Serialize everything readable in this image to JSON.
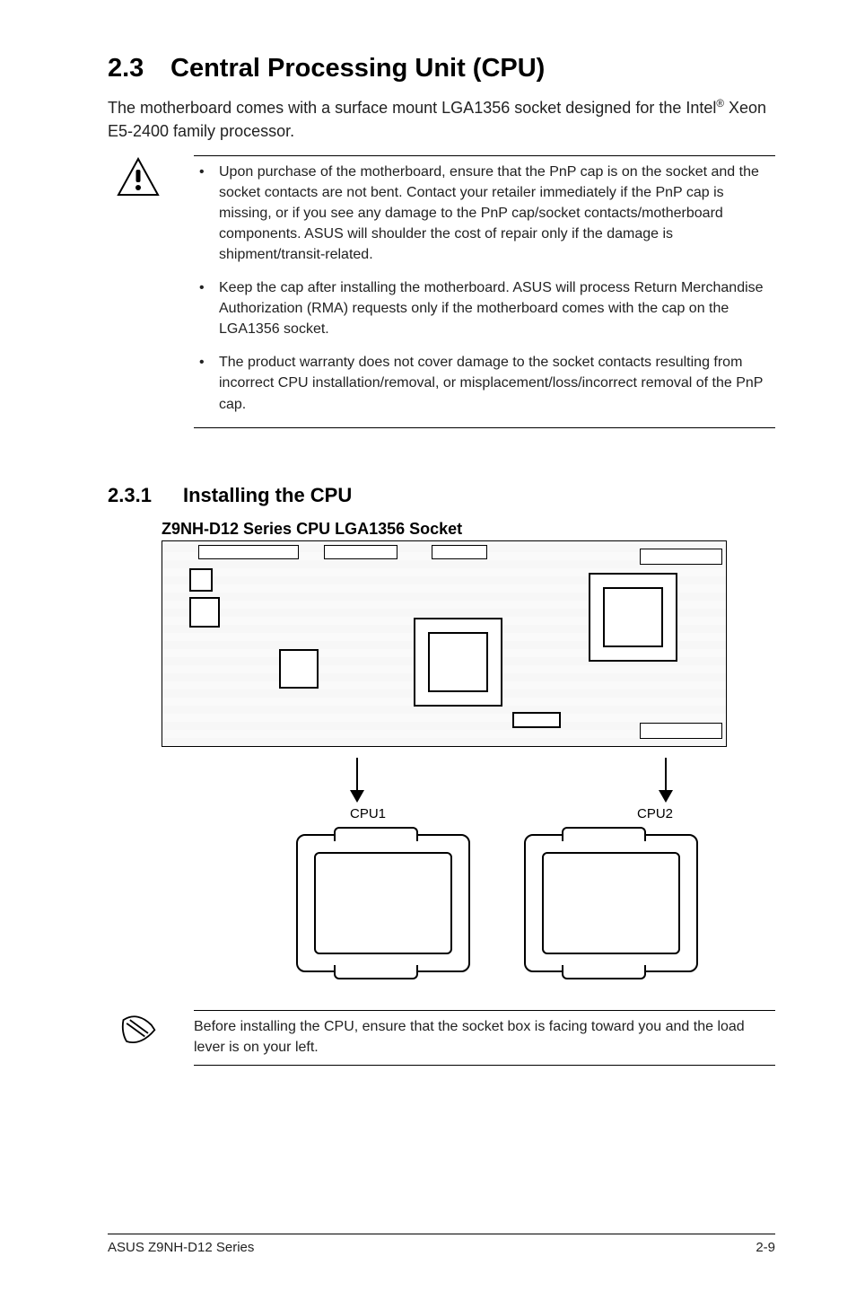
{
  "section": {
    "number": "2.3",
    "title": "Central Processing Unit (CPU)"
  },
  "intro": {
    "pre": "The motherboard comes with a surface mount LGA1356 socket designed for the Intel",
    "sup": "®",
    "post": " Xeon E5-2400 family processor."
  },
  "warnings": [
    "Upon purchase of the motherboard, ensure that the PnP cap is on the socket and the socket contacts are not bent. Contact your retailer immediately if the PnP cap is missing, or if you see any damage to the PnP cap/socket contacts/motherboard components. ASUS will shoulder the cost of repair only if the damage is shipment/transit-related.",
    "Keep the cap after installing the motherboard. ASUS will process Return Merchandise Authorization (RMA) requests only if the motherboard comes with the cap on the LGA1356 socket.",
    "The product warranty does not cover damage to the socket contacts resulting from incorrect CPU installation/removal, or misplacement/loss/incorrect removal of the PnP cap."
  ],
  "subsection": {
    "number": "2.3.1",
    "title": "Installing the CPU"
  },
  "diagram": {
    "title": "Z9NH-D12 Series CPU LGA1356 Socket",
    "labels": {
      "cpu1": "CPU1",
      "cpu2": "CPU2"
    }
  },
  "note": "Before installing the CPU, ensure that the socket box is facing toward you and the load lever is on your left.",
  "footer": {
    "left": "ASUS Z9NH-D12 Series",
    "right": "2-9"
  },
  "icons": {
    "warning": "warning-triangle",
    "note": "hand-pointer"
  }
}
